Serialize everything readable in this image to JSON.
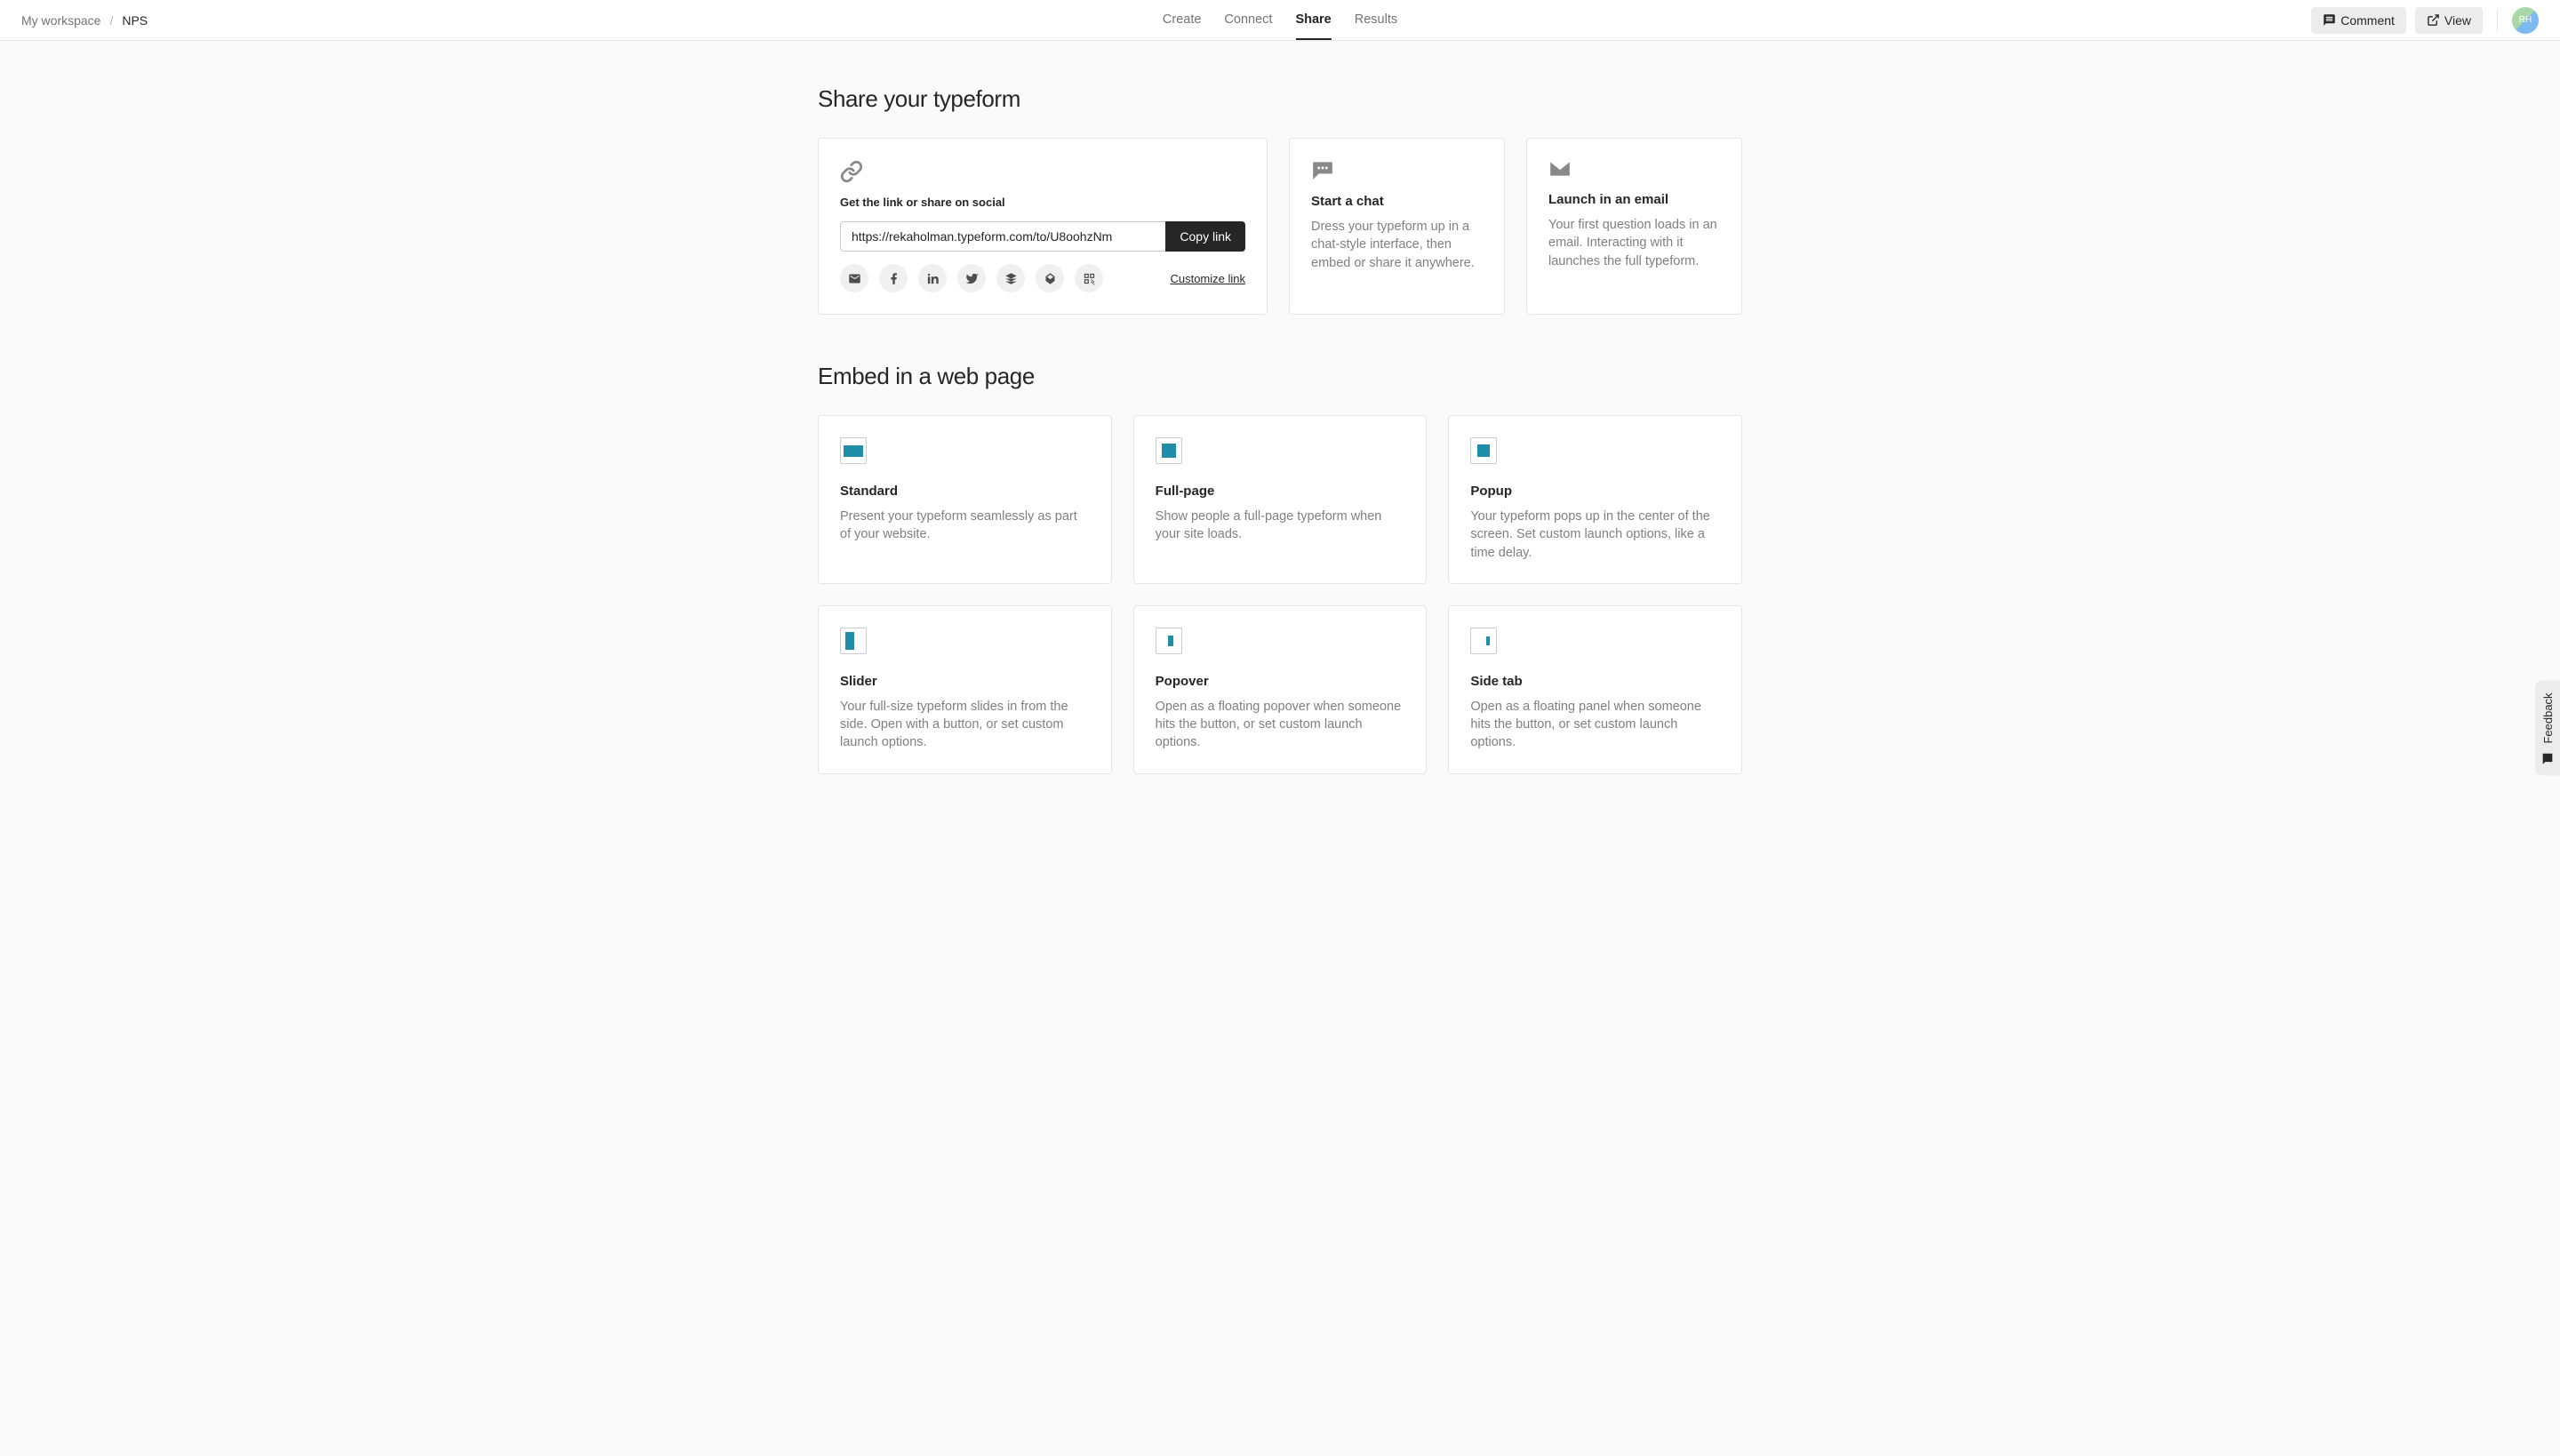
{
  "breadcrumb": {
    "workspace": "My workspace",
    "current": "NPS"
  },
  "nav": {
    "tabs": [
      "Create",
      "Connect",
      "Share",
      "Results"
    ],
    "active": "Share"
  },
  "header": {
    "comment": "Comment",
    "view": "View",
    "avatar": "RH"
  },
  "share": {
    "title": "Share your typeform",
    "link_card": {
      "subtitle": "Get the link or share on social",
      "url": "https://rekaholman.typeform.com/to/U8oohzNm",
      "copy": "Copy link",
      "customize": "Customize link"
    },
    "chat_card": {
      "title": "Start a chat",
      "desc": "Dress your typeform up in a chat-style interface, then embed or share it anywhere."
    },
    "email_card": {
      "title": "Launch in an email",
      "desc": "Your first question loads in an email. Interacting with it launches the full typeform."
    }
  },
  "embed": {
    "title": "Embed in a web page",
    "items": [
      {
        "title": "Standard",
        "desc": "Present your typeform seamlessly as part of your website."
      },
      {
        "title": "Full-page",
        "desc": "Show people a full-page typeform when your site loads."
      },
      {
        "title": "Popup",
        "desc": "Your typeform pops up in the center of the screen. Set custom launch options, like a time delay."
      },
      {
        "title": "Slider",
        "desc": "Your full-size typeform slides in from the side. Open with a button, or set custom launch options."
      },
      {
        "title": "Popover",
        "desc": "Open as a floating popover when someone hits the button, or set custom launch options."
      },
      {
        "title": "Side tab",
        "desc": "Open as a floating panel when someone hits the button, or set custom launch options."
      }
    ]
  },
  "feedback": "Feedback"
}
